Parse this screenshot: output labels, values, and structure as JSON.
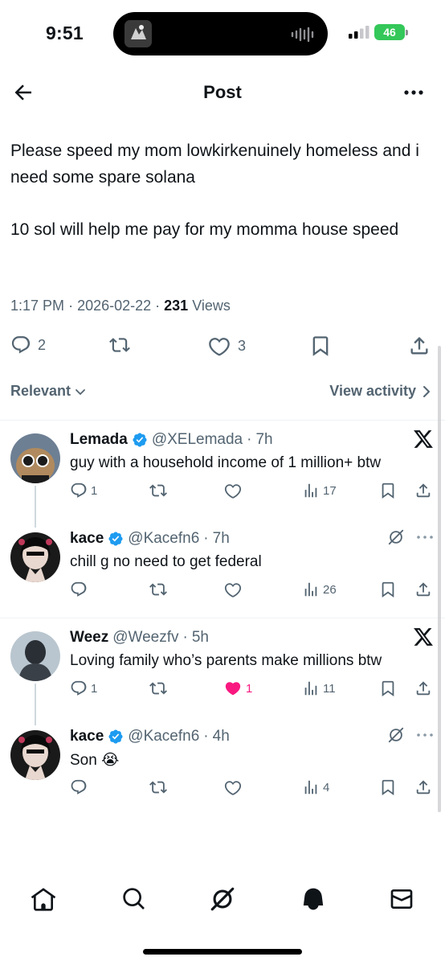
{
  "status_bar": {
    "time": "9:51",
    "battery": "46"
  },
  "header": {
    "title": "Post"
  },
  "post": {
    "text": "Please speed my mom lowkirkenuinely homeless and i need some spare solana\n\n10 sol will help me pay for my momma house speed",
    "time": "1:17 PM",
    "date": "2026-02-22",
    "views_count": "231",
    "views_label": "Views",
    "replies": "2",
    "likes": "3"
  },
  "sort": {
    "relevant_label": "Relevant",
    "activity_label": "View activity"
  },
  "replies": [
    {
      "name": "Lemada",
      "handle": "@XELemada",
      "time": "7h",
      "text": "guy with a household income of 1 million+ btw",
      "replies": "1",
      "likes": "",
      "views": "17",
      "liked": false
    },
    {
      "name": "kace",
      "handle": "@Kacefn6",
      "time": "7h",
      "text": "chill g no need to get federal",
      "replies": "",
      "likes": "",
      "views": "26",
      "liked": false
    },
    {
      "name": "Weez",
      "handle": "@Weezfv",
      "time": "5h",
      "text": "Loving family who’s parents make millions btw",
      "replies": "1",
      "likes": "1",
      "views": "11",
      "liked": true
    },
    {
      "name": "kace",
      "handle": "@Kacefn6",
      "time": "4h",
      "text": "Son 😭",
      "replies": "",
      "likes": "",
      "views": "4",
      "liked": false
    }
  ],
  "colors": {
    "accent": "#1d9bf0",
    "like": "#f91880",
    "muted": "#536471",
    "text": "#0f1419"
  },
  "icons": [
    "back-arrow-icon",
    "more-icon",
    "reply-icon",
    "repost-icon",
    "like-icon",
    "bookmark-icon",
    "share-icon",
    "views-icon",
    "verified-icon",
    "x-logo-icon",
    "grok-icon",
    "home-icon",
    "search-icon",
    "bell-icon",
    "mail-icon"
  ]
}
